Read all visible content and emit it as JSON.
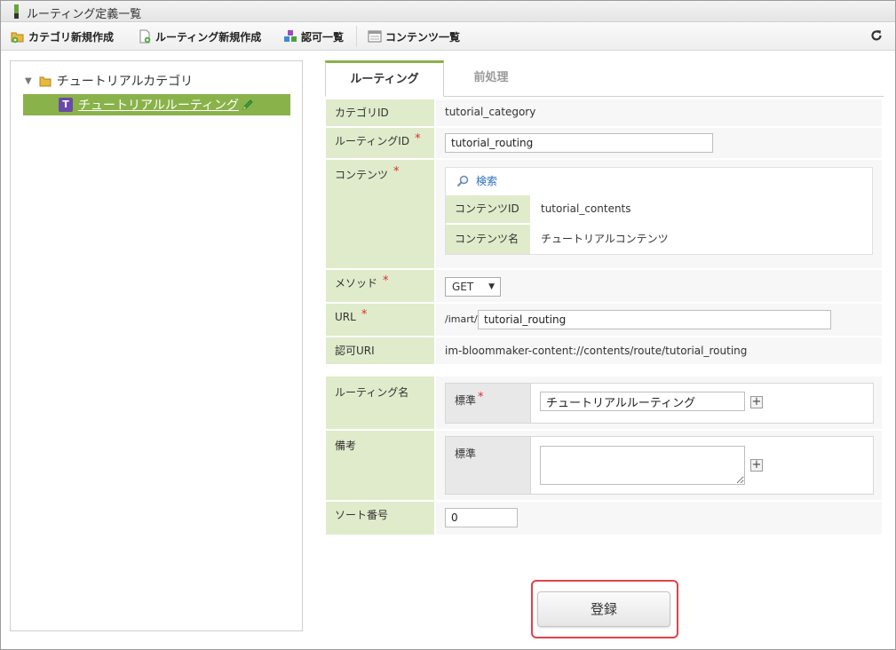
{
  "window": {
    "title": "ルーティング定義一覧"
  },
  "toolbar": {
    "add_category": "カテゴリ新規作成",
    "add_routing": "ルーティング新規作成",
    "authz": "認可一覧",
    "contents_list": "コンテンツ一覧",
    "refresh_icon": "refresh-icon"
  },
  "tree": {
    "category": "チュートリアルカテゴリ",
    "selected_item": "チュートリアルルーティング",
    "badge": "T"
  },
  "tabs": [
    {
      "label": "ルーティング",
      "active": true
    },
    {
      "label": "前処理",
      "active": false
    }
  ],
  "form": {
    "category_id": {
      "label": "カテゴリID",
      "value": "tutorial_category"
    },
    "routing_id": {
      "label": "ルーティングID",
      "value": "tutorial_routing"
    },
    "contents": {
      "label": "コンテンツ",
      "search_label": "検索",
      "contents_id_label": "コンテンツID",
      "contents_id_value": "tutorial_contents",
      "contents_name_label": "コンテンツ名",
      "contents_name_value": "チュートリアルコンテンツ"
    },
    "method": {
      "label": "メソッド",
      "value": "GET"
    },
    "url": {
      "label": "URL",
      "prefix": "/imart/",
      "value": "tutorial_routing"
    },
    "authz_uri": {
      "label": "認可URI",
      "value": "im-bloommaker-content://contents/route/tutorial_routing"
    },
    "routing_name": {
      "label": "ルーティング名",
      "locale_label": "標準",
      "value": "チュートリアルルーティング"
    },
    "note": {
      "label": "備考",
      "locale_label": "標準",
      "value": ""
    },
    "sort_no": {
      "label": "ソート番号",
      "value": "0"
    },
    "required_mark": "*"
  },
  "register_button": "登録",
  "colors": {
    "accent": "#8ab24a",
    "label_bg": "#dfebcb",
    "required": "#d9302f",
    "highlight": "#e0424a"
  }
}
